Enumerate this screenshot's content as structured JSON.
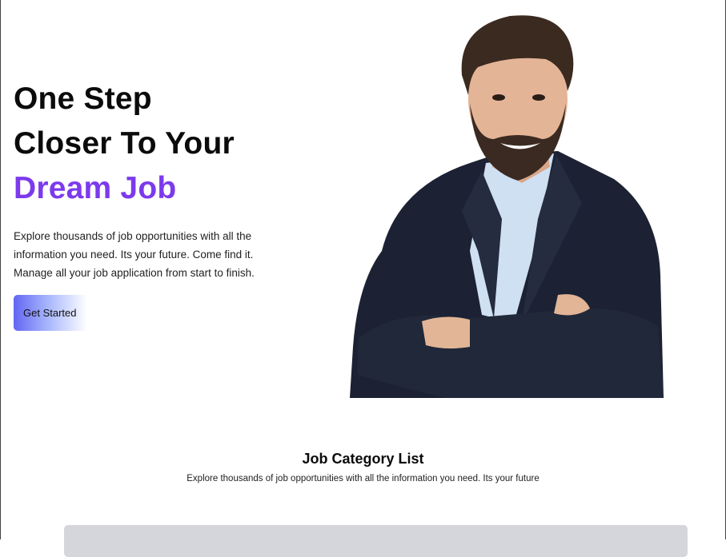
{
  "hero": {
    "headline_line1": "One Step",
    "headline_line2": "Closer To Your",
    "headline_accent": "Dream Job",
    "accent_color": "#7c3aed",
    "description_line1": "Explore thousands of job opportunities with all the",
    "description_line2": "information you need. Its your future. Come find it.",
    "description_line3": "Manage all your job application from start to finish.",
    "cta_label": "Get Started",
    "cta_gradient_start": "#6366f1"
  },
  "categories": {
    "title": "Job Category List",
    "subtitle": "Explore thousands of job opportunities with all the information you need. Its your future",
    "panel_color": "#d4d6db"
  }
}
